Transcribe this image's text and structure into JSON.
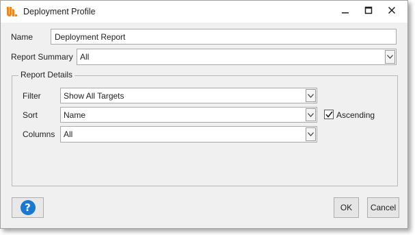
{
  "window": {
    "title": "Deployment Profile",
    "icons": {
      "app": "app-logo-icon",
      "minimize": "minimize-icon",
      "maximize": "maximize-icon",
      "close": "close-icon"
    }
  },
  "form": {
    "name_label": "Name",
    "name_value": "Deployment Report",
    "summary_label": "Report Summary",
    "summary_value": "All"
  },
  "details": {
    "group_label": "Report Details",
    "filter_label": "Filter",
    "filter_value": "Show All Targets",
    "sort_label": "Sort",
    "sort_value": "Name",
    "ascending_label": "Ascending",
    "ascending_checked": true,
    "columns_label": "Columns",
    "columns_value": "All"
  },
  "footer": {
    "help_symbol": "?",
    "ok_label": "OK",
    "cancel_label": "Cancel"
  },
  "colors": {
    "accent": "#1a78d0",
    "logo": "#f2851f",
    "dialog_bg": "#f0f0f0"
  }
}
